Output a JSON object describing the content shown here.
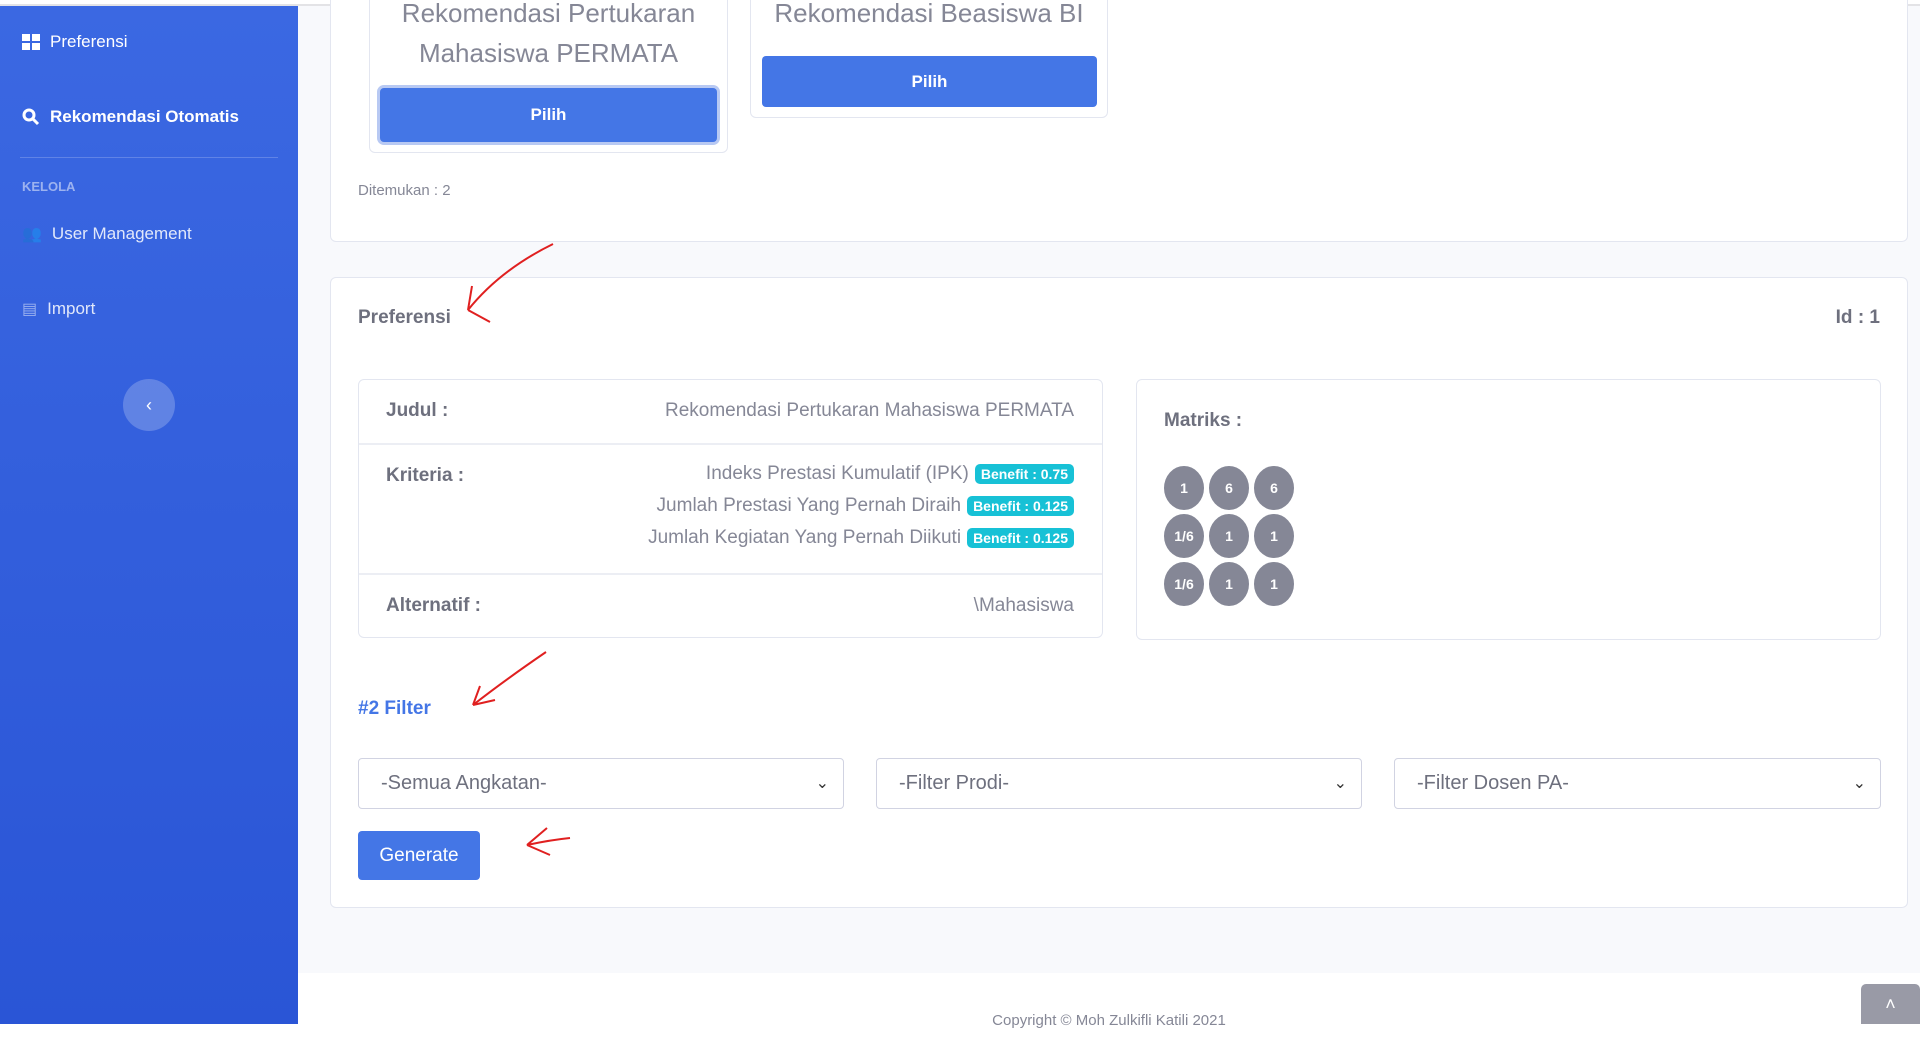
{
  "sidebar": {
    "items": [
      {
        "label": "Preferensi",
        "icon": "grid-icon"
      },
      {
        "label": "Rekomendasi Otomatis",
        "icon": "search-icon"
      }
    ],
    "section_heading": "KELOLA",
    "manage_items": [
      {
        "label": "User Management",
        "icon": "users-icon"
      },
      {
        "label": "Import",
        "icon": "import-icon"
      }
    ],
    "collapse_symbol": "‹"
  },
  "results": {
    "cards": [
      {
        "title_line1": "Rekomendasi Pertukaran",
        "title_line2": "Mahasiswa PERMATA",
        "button": "Pilih"
      },
      {
        "title_line1": "Rekomendasi Beasiswa BI",
        "title_line2": "",
        "button": "Pilih"
      }
    ],
    "found": "Ditemukan : 2"
  },
  "preferensi": {
    "title": "Preferensi",
    "id_label": "Id : 1",
    "judul_label": "Judul :",
    "judul_value": "Rekomendasi Pertukaran Mahasiswa PERMATA",
    "kriteria_label": "Kriteria :",
    "kriteria": [
      {
        "name": "Indeks Prestasi Kumulatif (IPK)",
        "badge": "Benefit : 0.75"
      },
      {
        "name": "Jumlah Prestasi Yang Pernah Diraih",
        "badge": "Benefit : 0.125"
      },
      {
        "name": "Jumlah Kegiatan Yang Pernah Diikuti",
        "badge": "Benefit : 0.125"
      }
    ],
    "alternatif_label": "Alternatif :",
    "alternatif_value": "\\Mahasiswa",
    "matriks_label": "Matriks :",
    "matriks": [
      [
        "1",
        "6",
        "6"
      ],
      [
        "1/6",
        "1",
        "1"
      ],
      [
        "1/6",
        "1",
        "1"
      ]
    ]
  },
  "filter": {
    "title": "#2 Filter",
    "selects": [
      "-Semua Angkatan-",
      "-Filter Prodi-",
      "-Filter Dosen PA-"
    ],
    "generate": "Generate"
  },
  "footer": {
    "copyright": "Copyright © Moh Zulkifli Katili 2021",
    "to_top_symbol": "˄"
  },
  "colors": {
    "sidebar": "#2f5bd8",
    "primary": "#4476e6",
    "badge": "#17c1d6",
    "annotation": "#e02020"
  }
}
